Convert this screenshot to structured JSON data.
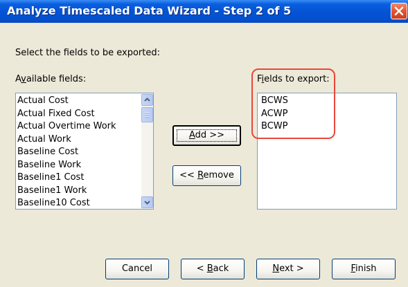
{
  "window": {
    "title": "Analyze Timescaled Data Wizard - Step 2 of 5"
  },
  "instruction": "Select the fields to be exported:",
  "available": {
    "label_pre": "A",
    "label_key": "v",
    "label_post": "ailable fields:",
    "items": [
      "Actual Cost",
      "Actual Fixed Cost",
      "Actual Overtime Work",
      "Actual Work",
      "Baseline Cost",
      "Baseline Work",
      "Baseline1 Cost",
      "Baseline1 Work",
      "Baseline10 Cost"
    ]
  },
  "export": {
    "label_pre": "F",
    "label_key": "i",
    "label_post": "elds to export:",
    "items": [
      "BCWS",
      "ACWP",
      "BCWP"
    ]
  },
  "buttons": {
    "add": {
      "key": "A",
      "rest": "dd >>"
    },
    "remove": {
      "pre": "<< ",
      "key": "R",
      "rest": "emove"
    },
    "cancel": "Cancel",
    "back": {
      "pre": "< ",
      "key": "B",
      "rest": "ack"
    },
    "next": {
      "key": "N",
      "rest": "ext >"
    },
    "finish": {
      "key": "F",
      "rest": "inish"
    }
  },
  "icons": {
    "close": "close-icon",
    "scroll_up": "arrow-up-icon",
    "scroll_down": "arrow-down-icon",
    "thumb_grip": "grip-icon"
  },
  "colors": {
    "title_bar": "#0554d6",
    "dialog_bg": "#ece9d8",
    "close_button": "#e2552f",
    "highlight_outline": "#e8473a"
  }
}
